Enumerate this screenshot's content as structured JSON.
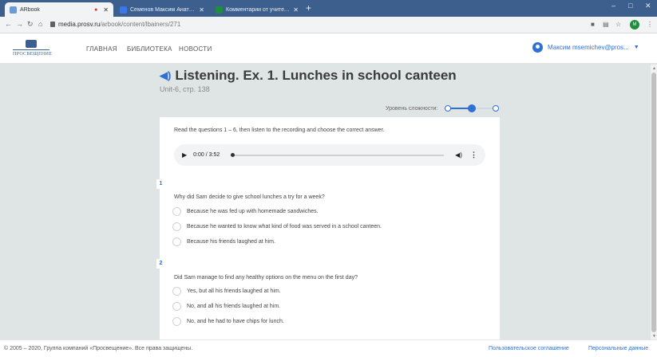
{
  "browser": {
    "tabs": [
      {
        "title": "ARbook",
        "active": true,
        "favicon_color": "#6b9bd2"
      },
      {
        "title": "Семенов Максим Анатольевич",
        "active": false,
        "favicon_color": "#3b78e7"
      },
      {
        "title": "Комментарии от учителей · Go",
        "active": false,
        "favicon_color": "#1e8e3e"
      }
    ],
    "new_tab": "+",
    "window": {
      "minimize": "–",
      "maximize": "□",
      "close": "✕"
    },
    "url_host": "media.prosv.ru",
    "url_path": "/arbook/content/lbainers/271",
    "profile_initial": "М"
  },
  "site": {
    "logo_text": "ПРОСВЕЩЕНИЕ",
    "nav": [
      "ГЛАВНАЯ",
      "БИБЛИОТЕКА",
      "НОВОСТИ"
    ],
    "user_email": "Максим msemichev@pros..."
  },
  "lesson": {
    "title": "Listening. Ex. 1. Lunches in school canteen",
    "subtitle": "Unit-6, стр. 138",
    "difficulty_label": "Уровень сложности:",
    "difficulty_level": 2,
    "difficulty_max": 3,
    "instructions": "Read the questions 1 – 6, then listen to the recording and choose the correct answer.",
    "audio": {
      "time": "0:00 / 3:52"
    },
    "questions": [
      {
        "number": "1",
        "text": "Why did Sam decide to give school lunches a try for a week?",
        "options": [
          "Because he was fed up with homemade sandwiches.",
          "Because he wanted to know what kind of food was served in a school canteen.",
          "Because his friends laughed at him."
        ]
      },
      {
        "number": "2",
        "text": "Did Sam manage to find any healthy options on the menu on the first day?",
        "options": [
          "Yes, but all his friends laughed at him.",
          "No, and all his friends laughed at him.",
          "No, and he had to have chips for lunch."
        ]
      }
    ]
  },
  "footer": {
    "copyright": "© 2005 – 2020, Группа компаний «Просвещение». Все права защищены.",
    "terms": "Пользовательское соглашение",
    "privacy": "Персональные данные"
  },
  "colors": {
    "accent": "#2f6fd6",
    "browser_frame": "#3c5f8e",
    "page_bg": "#dfe4e4"
  }
}
